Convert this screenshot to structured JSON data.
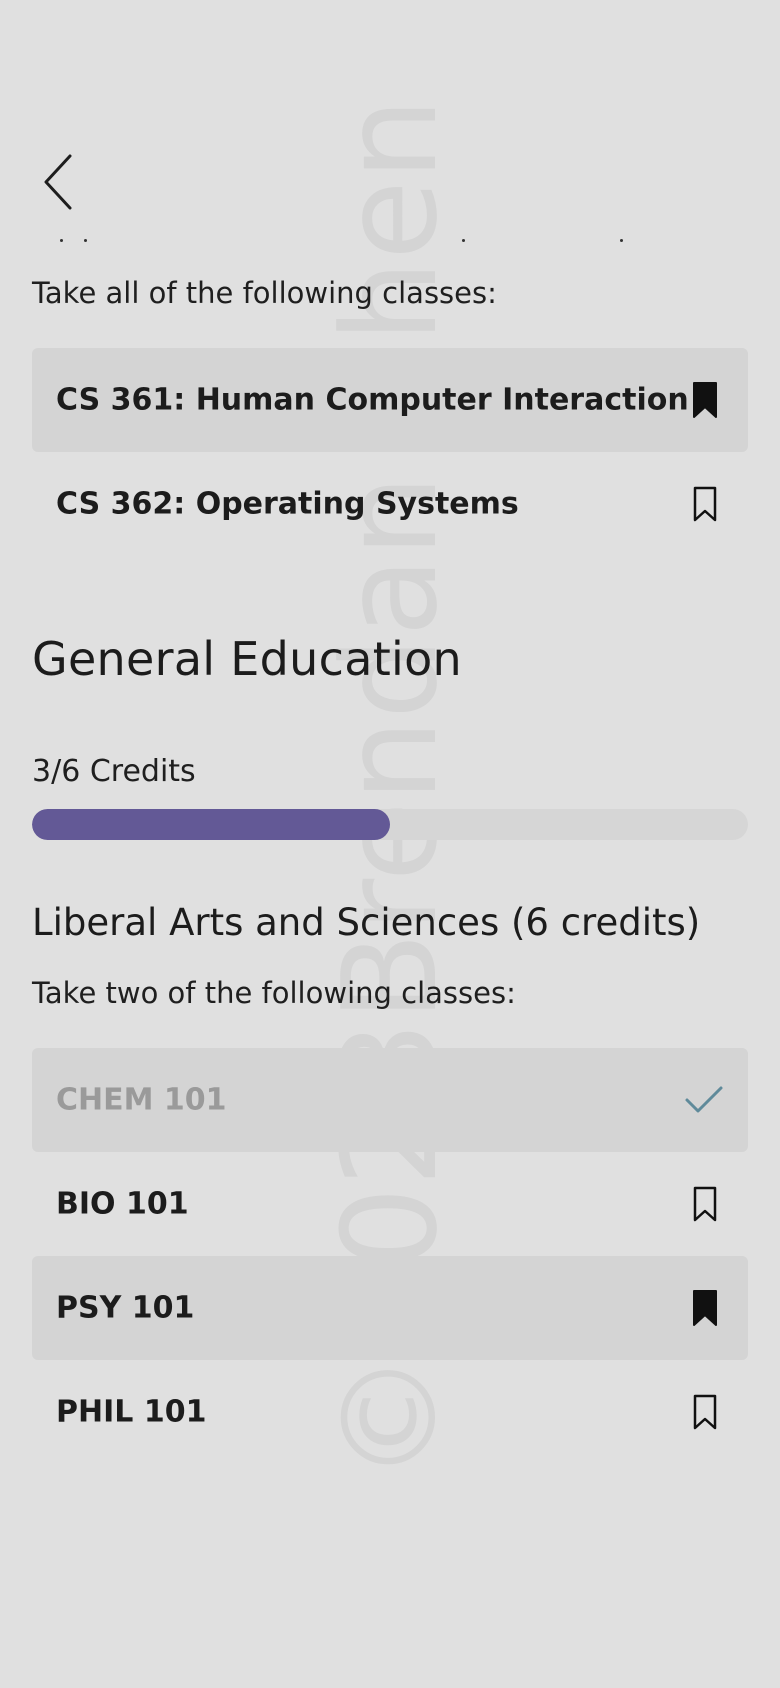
{
  "navigation": {
    "back_icon": "chevron-left-icon"
  },
  "major_section": {
    "instruction": "Take all of the following classes:",
    "courses": [
      {
        "label": "CS 361: Human Computer Interaction",
        "state": "bookmarked",
        "icon": "bookmark-filled-icon"
      },
      {
        "label": "CS 362: Operating Systems",
        "state": "not-bookmarked",
        "icon": "bookmark-outline-icon"
      }
    ]
  },
  "general_education": {
    "title": "General Education",
    "credits_label": "3/6 Credits",
    "progress_fraction": 0.5,
    "progress_color": "#635996",
    "subsection": {
      "title": "Liberal Arts and Sciences (6 credits)",
      "instruction": "Take two of the following classes:",
      "courses": [
        {
          "label": "CHEM 101",
          "state": "completed",
          "icon": "checkmark-icon"
        },
        {
          "label": "BIO 101",
          "state": "not-bookmarked",
          "icon": "bookmark-outline-icon"
        },
        {
          "label": "PSY 101",
          "state": "bookmarked",
          "icon": "bookmark-filled-icon"
        },
        {
          "label": "PHIL 101",
          "state": "not-bookmarked",
          "icon": "bookmark-outline-icon"
        }
      ]
    }
  },
  "watermark": "©2023Brendan Chen",
  "colors": {
    "background": "#e0e0e0",
    "row_shade": "#d4d4d4",
    "check": "#5f8a9a",
    "accent": "#635996"
  }
}
